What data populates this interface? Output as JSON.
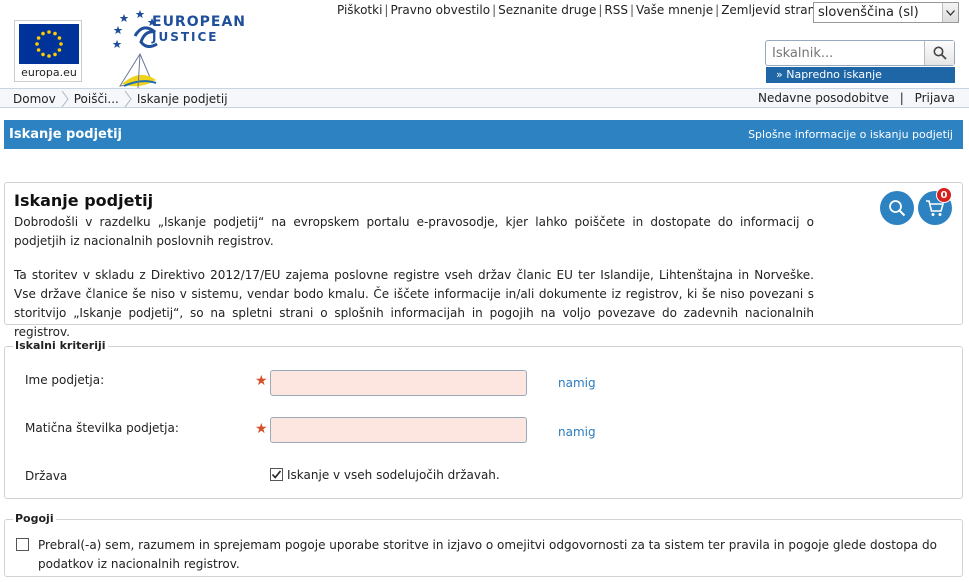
{
  "header": {
    "eu_logo_text": "europa.eu",
    "ej_logo_line1": "EUROPEAN",
    "ej_logo_line2": "JUSTICE",
    "top_links": [
      "Piškotki",
      "Pravno obvestilo",
      "Seznanite druge",
      "RSS",
      "Vaše mnenje",
      "Zemljevid strani"
    ],
    "language": "slovenščina (sl)",
    "search_placeholder": "Iskalnik...",
    "advanced_search": "» Napredno iskanje"
  },
  "breadcrumb": {
    "items": [
      "Domov",
      "Poišči...",
      "Iskanje podjetij"
    ],
    "recent": "Nedavne posodobitve",
    "sep": "|",
    "login": "Prijava"
  },
  "titlebar": {
    "title": "Iskanje podjetij",
    "info_link": "Splošne informacije o iskanju podjetij"
  },
  "intro": {
    "heading": "Iskanje podjetij",
    "paragraph1": "Dobrodošli v razdelku „Iskanje podjetij“ na evropskem portalu e-pravosodje, kjer lahko poiščete in dostopate do informacij o podjetjih iz nacionalnih poslovnih registrov.",
    "paragraph2": "Ta storitev v skladu z Direktivo 2012/17/EU zajema poslovne registre vseh držav članic EU ter Islandije, Lihtenštajna in Norveške. Vse države članice še niso v sistemu, vendar bodo kmalu. Če iščete informacije in/ali dokumente iz registrov, ki še niso povezani s storitvijo „Iskanje podjetij“, so na spletni strani o splošnih informacijah in pogojih na voljo povezave do zadevnih nacionalnih registrov.",
    "cart_count": "0"
  },
  "criteria": {
    "legend": "Iskalni kriteriji",
    "company_name_label": "Ime podjetja:",
    "reg_number_label": "Matična številka podjetja:",
    "required_mark": "★",
    "hint": "namig",
    "country_label": "Država",
    "all_countries_label": "Iskanje v vseh sodelujočih državah.",
    "all_countries_checked": true
  },
  "terms": {
    "legend": "Pogoji",
    "text": "Prebral(-a) sem, razumem in sprejemam pogoje uporabe storitve in izjavo o omejitvi odgovornosti za ta sistem ter pravila in pogoje glede dostopa do podatkov iz nacionalnih registrov.",
    "checked": false
  },
  "colors": {
    "brand_blue": "#2d82c2",
    "link_blue": "#2a7cbf",
    "required_input_bg": "#fde6df",
    "required_star": "#d2502a",
    "badge_red": "#d62020"
  }
}
